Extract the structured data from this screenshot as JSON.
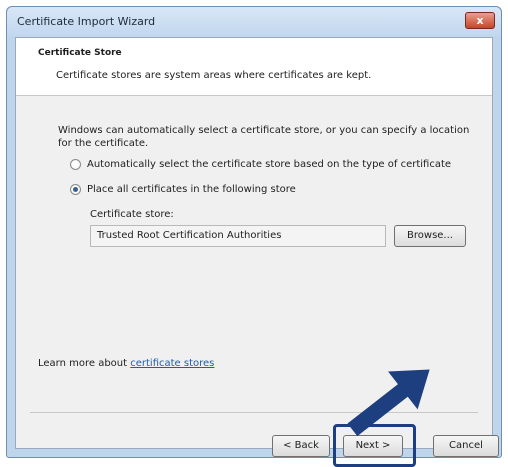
{
  "window": {
    "title": "Certificate Import Wizard",
    "close_glyph": "x"
  },
  "header": {
    "title": "Certificate Store",
    "description": "Certificate stores are system areas where certificates are kept."
  },
  "body": {
    "intro": "Windows can automatically select a certificate store, or you can specify a location for the certificate.",
    "options": [
      {
        "label": "Automatically select the certificate store based on the type of certificate",
        "selected": false
      },
      {
        "label": "Place all certificates in the following store",
        "selected": true
      }
    ],
    "store_label": "Certificate store:",
    "store_value": "Trusted Root Certification Authorities",
    "browse_label": "Browse..."
  },
  "footer": {
    "learn_prefix": "Learn more about ",
    "learn_link": "certificate stores",
    "back_label": "< Back",
    "next_label": "Next >",
    "cancel_label": "Cancel"
  },
  "annotations": {
    "highlight_color": "#1d3f80",
    "arrow_color": "#1d3f80",
    "pointer": "arrow-icon"
  }
}
